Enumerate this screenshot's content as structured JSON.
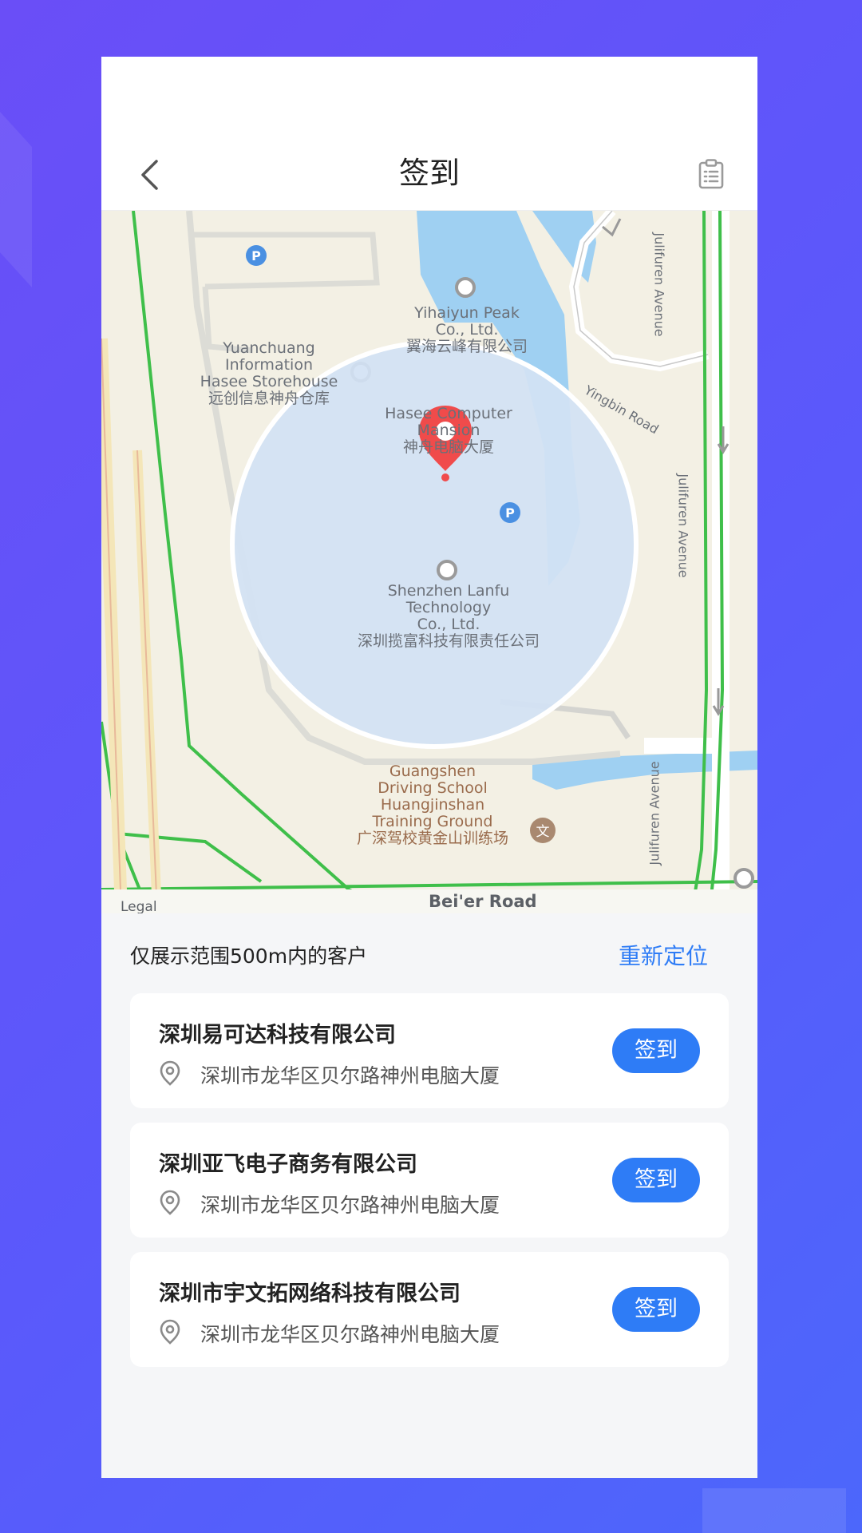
{
  "header": {
    "title": "签到",
    "back_icon": "chevron-left-icon",
    "records_icon": "clipboard-icon"
  },
  "map": {
    "labels": {
      "yihaiyun": "Yihaiyun Peak\nCo., Ltd.\n翼海云峰有限公司",
      "yuanchuang": "Yuanchuang\nInformation\nHasee Storehouse\n远创信息神舟仓库",
      "hasee": "Hasee Computer\nMansion\n神舟电脑大厦",
      "lanfu": "Shenzhen Lanfu\nTechnology\nCo., Ltd.\n深圳揽富科技有限责任公司",
      "guangshen": "Guangshen\nDriving School\nHuangjinshan\nTraining Ground\n广深驾校黄金山训练场",
      "yingbin_road": "Yingbin Road",
      "julifuren_1": "Julifuren Avenue",
      "julifuren_2": "Julifuren Avenue",
      "julifuren_3": "Julifuren Avenue",
      "beier_road": "Bei'er Road",
      "legal": "Legal"
    },
    "pin_color": "#f04b4b",
    "radius_color": "#d2e2f4"
  },
  "info": {
    "range_text": "仅展示范围500m内的客户",
    "relocate_label": "重新定位"
  },
  "customers": [
    {
      "name": "深圳易可达科技有限公司",
      "address": "深圳市龙华区贝尔路神州电脑大厦",
      "button": "签到"
    },
    {
      "name": "深圳亚飞电子商务有限公司",
      "address": "深圳市龙华区贝尔路神州电脑大厦",
      "button": "签到"
    },
    {
      "name": "深圳市宇文拓网络科技有限公司",
      "address": "深圳市龙华区贝尔路神州电脑大厦",
      "button": "签到"
    }
  ],
  "colors": {
    "accent": "#2e7cf6",
    "background_start": "#6a4ef7",
    "background_end": "#4c67fb"
  }
}
